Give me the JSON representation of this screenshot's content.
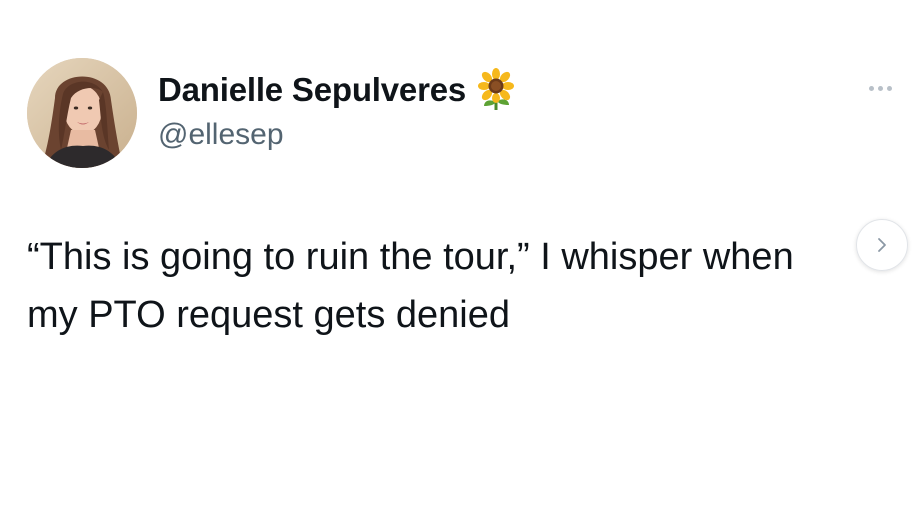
{
  "tweet": {
    "author": {
      "display_name": "Danielle Sepulveres",
      "emoji": "sunflower",
      "handle": "@ellesep",
      "avatar_icon": "profile-photo"
    },
    "more_icon": "more-horizontal-icon",
    "text_lines": [
      "“This is going to ruin the tour,” I whisper when",
      "my PTO request gets denied"
    ],
    "next_icon": "chevron-right-icon"
  },
  "colors": {
    "text": "#0f1419",
    "secondary_text": "#536471",
    "background": "#ffffff"
  }
}
